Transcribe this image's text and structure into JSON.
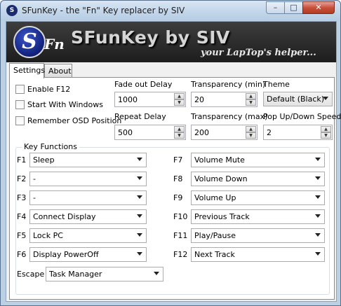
{
  "window": {
    "title": "SFunKey - the \"Fn\" Key replacer by SIV",
    "minimize_symbol": "–",
    "maximize_symbol": "□",
    "close_symbol": "✕"
  },
  "banner": {
    "logo_s": "S",
    "logo_fn": "Fn",
    "title": "SFunKey by SIV",
    "subtitle": "your LapTop's helper..."
  },
  "tabs": [
    "Settings",
    "About"
  ],
  "settings": {
    "checkboxes": [
      {
        "label": "Enable F12",
        "checked": false
      },
      {
        "label": "Start With Windows",
        "checked": false
      },
      {
        "label": "Remember OSD Position",
        "checked": false
      }
    ],
    "fade_out_delay": {
      "label": "Fade out Delay",
      "value": "1000"
    },
    "transparency_min": {
      "label": "Transparency (min)",
      "value": "20"
    },
    "theme": {
      "label": "Theme",
      "value": "Default (Black)"
    },
    "repeat_delay": {
      "label": "Repeat Delay",
      "value": "500"
    },
    "transparency_max": {
      "label": "Transparency (max)",
      "value": "200"
    },
    "popup_speed": {
      "label": "Pop Up/Down Speed",
      "value": "2"
    }
  },
  "key_functions": {
    "title": "Key Functions",
    "left": [
      {
        "key": "F1",
        "value": "Sleep"
      },
      {
        "key": "F2",
        "value": "-"
      },
      {
        "key": "F3",
        "value": "-"
      },
      {
        "key": "F4",
        "value": "Connect Display"
      },
      {
        "key": "F5",
        "value": "Lock PC"
      },
      {
        "key": "F6",
        "value": "Display PowerOff"
      }
    ],
    "right": [
      {
        "key": "F7",
        "value": "Volume Mute"
      },
      {
        "key": "F8",
        "value": "Volume Down"
      },
      {
        "key": "F9",
        "value": "Volume Up"
      },
      {
        "key": "F10",
        "value": "Previous Track"
      },
      {
        "key": "F11",
        "value": "Play/Pause"
      },
      {
        "key": "F12",
        "value": "Next Track"
      }
    ],
    "escape": {
      "key": "Escape",
      "value": "Task Manager"
    }
  },
  "icons": {
    "spin_up": "▲",
    "spin_down": "▼"
  },
  "colors": {
    "banner_bg": "#2a2a2a",
    "logo_blue": "#1b2d6b",
    "close_red": "#c7503a"
  }
}
